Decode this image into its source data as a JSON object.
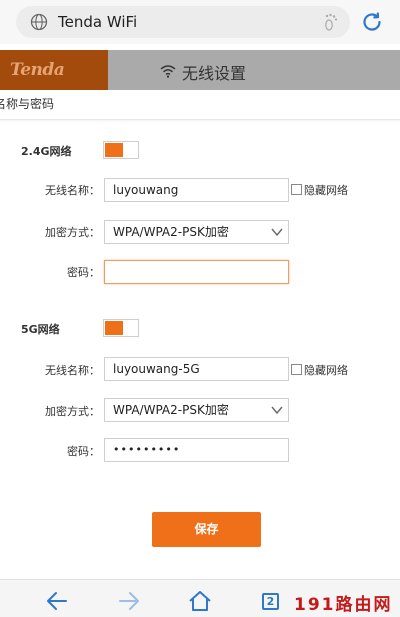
{
  "browser": {
    "url_text": "Tenda WiFi",
    "tab_count": "2"
  },
  "header": {
    "logo": "Tenda",
    "title": "无线设置"
  },
  "section": {
    "title": "名称与密码"
  },
  "band_24": {
    "label": "2.4G网络",
    "enabled": true,
    "ssid_label": "无线名称：",
    "ssid_value": "luyouwang",
    "hide_label": "隐藏网络",
    "encrypt_label": "加密方式：",
    "encrypt_value": "WPA/WPA2-PSK加密",
    "password_label": "密码：",
    "password_value": ""
  },
  "band_5": {
    "label": "5G网络",
    "enabled": true,
    "ssid_label": "无线名称：",
    "ssid_value": "luyouwang-5G",
    "hide_label": "隐藏网络",
    "encrypt_label": "加密方式：",
    "encrypt_value": "WPA/WPA2-PSK加密",
    "password_label": "密码：",
    "password_value": "•••••••••"
  },
  "actions": {
    "save_label": "保存"
  },
  "watermark": "191路由网",
  "colors": {
    "accent": "#ef7019",
    "logo_bg": "#a34a0d",
    "header_bg": "#aaaaaa",
    "nav_blue": "#2f78c9"
  }
}
